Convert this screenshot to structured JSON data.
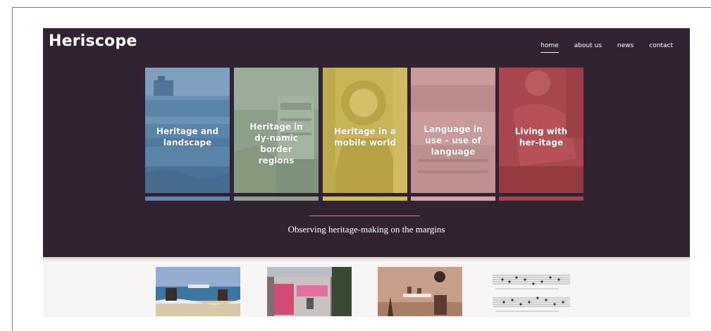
{
  "site": {
    "logo": "Heriscope",
    "tagline": "Observing heritage-making on the margins"
  },
  "nav": {
    "items": [
      {
        "label": "home",
        "active": true
      },
      {
        "label": "about us",
        "active": false
      },
      {
        "label": "news",
        "active": false
      },
      {
        "label": "contact",
        "active": false
      }
    ]
  },
  "themes": [
    {
      "label": "Heritage and landscape",
      "color": "#5d86a8"
    },
    {
      "label": "Heritage in dy-namic border regions",
      "color": "#8fa08a"
    },
    {
      "label": "Heritage in a mobile world",
      "color": "#c8b45a"
    },
    {
      "label": "Language in use – use of language",
      "color": "#c99a99"
    },
    {
      "label": "Living with her-itage",
      "color": "#a8474f"
    }
  ],
  "thumbnails": [
    {
      "name": "beach-photo"
    },
    {
      "name": "graffiti-building-photo"
    },
    {
      "name": "museum-exhibit-photo"
    },
    {
      "name": "sheet-music-image"
    }
  ],
  "colors": {
    "hero_bg": "#322333",
    "rule": "#c98a77"
  }
}
